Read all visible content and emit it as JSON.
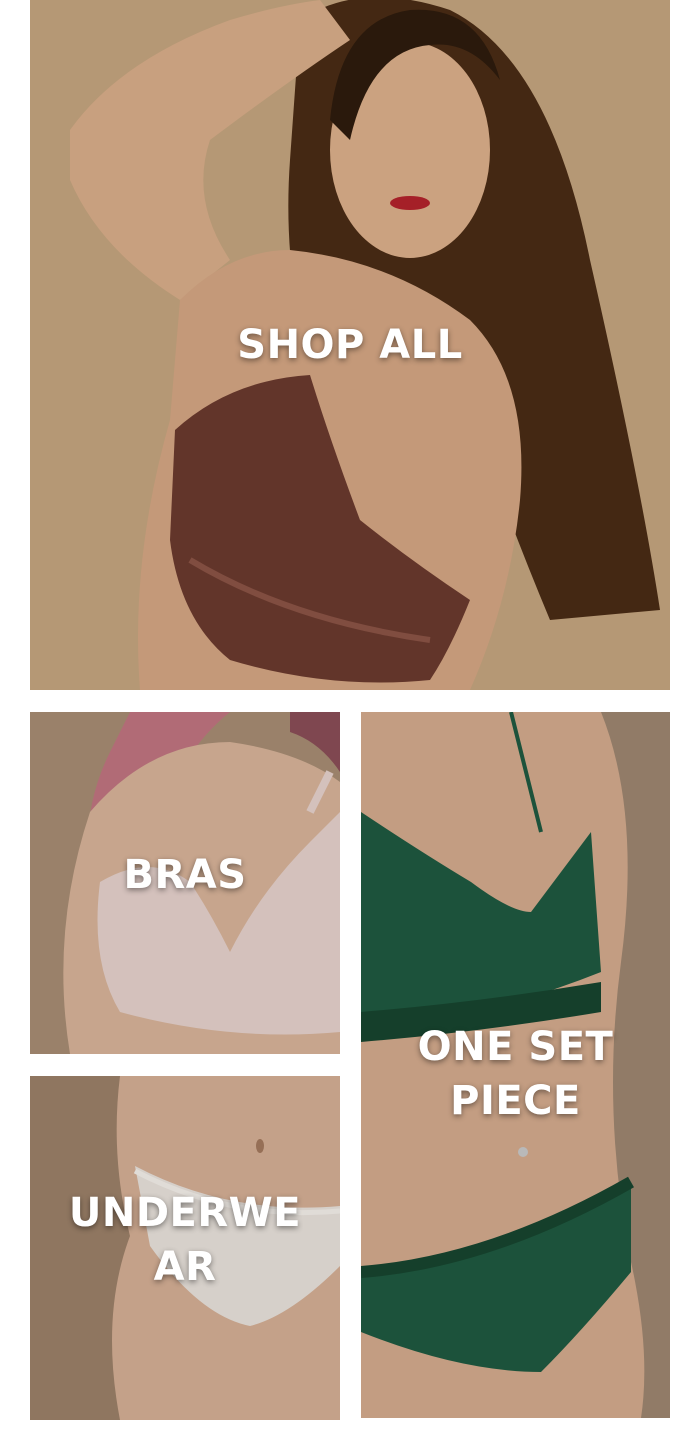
{
  "categories": {
    "shop_all": {
      "label": "SHOP ALL",
      "background_color": "#C5A57F",
      "garment_color": "#6B3A2E",
      "skin_color": "#D9AE8A",
      "hair_color": "#3A2413"
    },
    "bras": {
      "label": "BRAS",
      "background_color": "#A88D74",
      "garment_color": "#E6D2CC",
      "skin_color": "#D8B49A",
      "hair_color": "#C07580"
    },
    "underwear": {
      "label": "UNDERWEAR",
      "background_color": "#9C8069",
      "garment_color": "#E9E2DC",
      "skin_color": "#D5AF95"
    },
    "one_set_piece": {
      "label": "ONE SET PIECE",
      "background_color": "#9E8670",
      "garment_color": "#1F5A40",
      "skin_color": "#D4AB8E"
    }
  }
}
